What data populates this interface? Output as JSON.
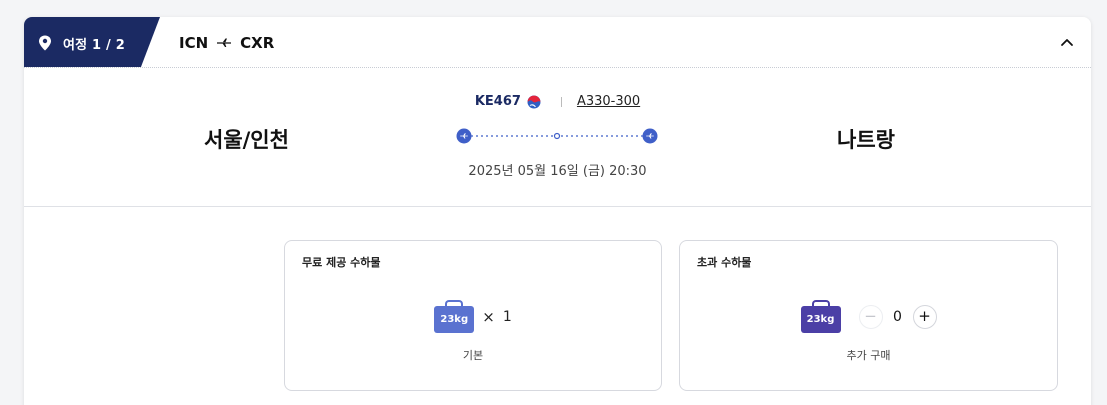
{
  "itinerary": {
    "label": "여정 1 / 2",
    "origin_code": "ICN",
    "destination_code": "CXR"
  },
  "flight": {
    "number": "KE467",
    "aircraft": "A330-300",
    "from_city": "서울/인천",
    "to_city": "나트랑",
    "departure": "2025년 05월 16일 (금) 20:30"
  },
  "baggage": {
    "free": {
      "title": "무료 제공 수하물",
      "weight": "23kg",
      "times_symbol": "×",
      "count": "1",
      "caption": "기본"
    },
    "extra": {
      "title": "초과 수하물",
      "weight": "23kg",
      "minus": "−",
      "quantity": "0",
      "plus": "+",
      "caption": "추가 구매"
    }
  },
  "colors": {
    "navy": "#1b2a63",
    "route_blue": "#3f5fc8",
    "bag_free": "#5a72d0",
    "bag_extra": "#4b3fa6"
  },
  "icons": {
    "itinerary": "location-pin-icon",
    "route": "plane-icon",
    "collapse": "chevron-up-icon",
    "airline": "korean-air-logo-icon",
    "baggage": "suitcase-icon"
  }
}
